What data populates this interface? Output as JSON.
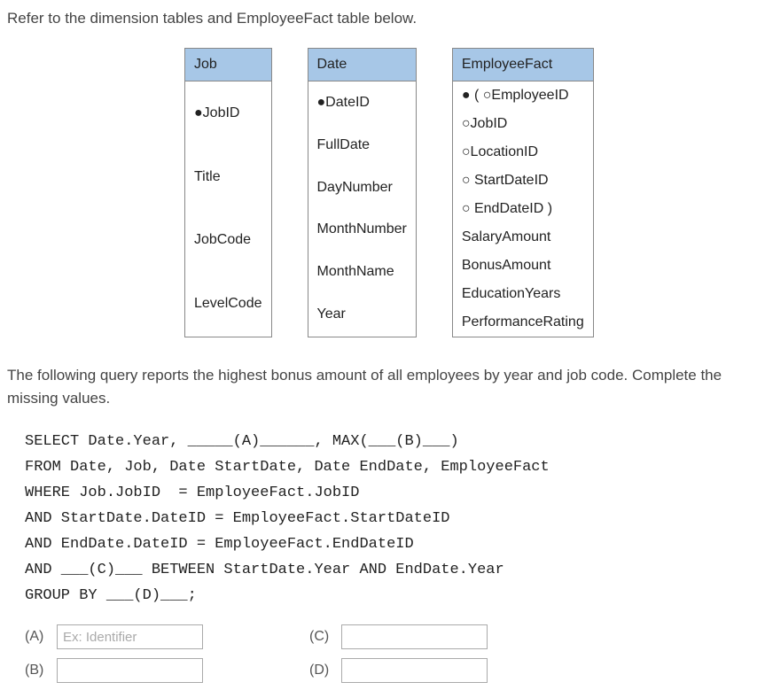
{
  "intro": "Refer to the dimension tables and EmployeeFact table below.",
  "tables": {
    "job": {
      "header": "Job",
      "rows": [
        "●JobID",
        "Title",
        "JobCode",
        "LevelCode"
      ]
    },
    "date": {
      "header": "Date",
      "rows": [
        "●DateID",
        "FullDate",
        "DayNumber",
        "MonthNumber",
        "MonthName",
        "Year"
      ]
    },
    "fact": {
      "header": "EmployeeFact",
      "rows": [
        "● ( ○EmployeeID",
        "○JobID",
        "○LocationID",
        "○ StartDateID",
        "○ EndDateID )",
        "SalaryAmount",
        "BonusAmount",
        "EducationYears",
        "PerformanceRating"
      ]
    }
  },
  "description": "The following query reports the highest bonus amount of all employees by year and job code. Complete the missing values.",
  "sql": {
    "line1": "SELECT Date.Year, _____(A)______, MAX(___(B)___)",
    "line2": "FROM Date, Job, Date StartDate, Date EndDate, EmployeeFact",
    "line3": "WHERE Job.JobID  = EmployeeFact.JobID",
    "line4": "AND StartDate.DateID = EmployeeFact.StartDateID",
    "line5": "AND EndDate.DateID = EmployeeFact.EndDateID",
    "line6": "AND ___(C)___ BETWEEN StartDate.Year AND EndDate.Year",
    "line7": "GROUP BY ___(D)___;"
  },
  "answers": {
    "a_label": "(A)",
    "a_placeholder": "Ex: Identifier",
    "b_label": "(B)",
    "c_label": "(C)",
    "d_label": "(D)"
  }
}
